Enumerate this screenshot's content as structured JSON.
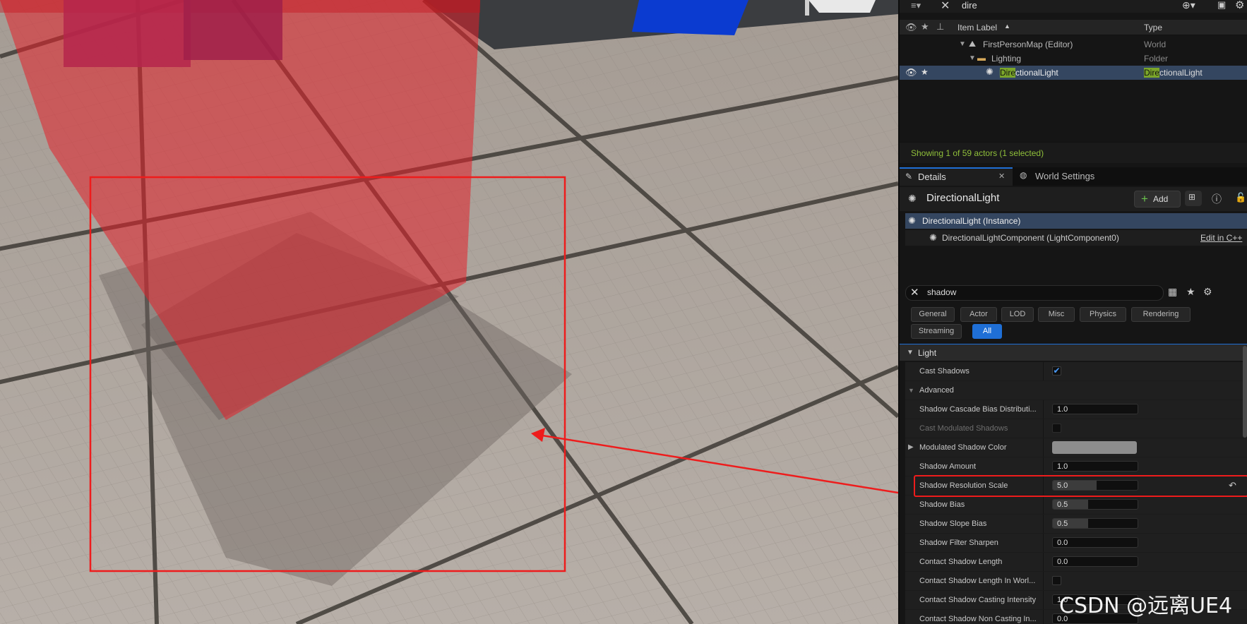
{
  "outliner": {
    "search_value": "dire",
    "col_label": "Item Label",
    "col_type": "Type",
    "rows": [
      {
        "label": "FirstPersonMap (Editor)",
        "type": "World"
      },
      {
        "label": "Lighting",
        "type": "Folder"
      },
      {
        "label_hl": "Dire",
        "label_rest": "ctionalLight",
        "type_hl": "Dire",
        "type_rest": "ctionalLight"
      }
    ],
    "status": "Showing 1 of 59 actors (1 selected)"
  },
  "tabs": {
    "details": "Details",
    "world_settings": "World Settings"
  },
  "details": {
    "actor_name": "DirectionalLight",
    "add_label": "Add",
    "instance_label": "DirectionalLight (Instance)",
    "component_label": "DirectionalLightComponent (LightComponent0)",
    "edit_cpp": "Edit in C++",
    "search_value": "shadow",
    "categories": [
      "General",
      "Actor",
      "LOD",
      "Misc",
      "Physics",
      "Rendering",
      "Streaming",
      "All"
    ],
    "section_light": "Light",
    "advanced_label": "Advanced",
    "props": {
      "cast_shadows": "Cast Shadows",
      "cascade_bias": "Shadow Cascade Bias Distributi...",
      "cascade_bias_val": "1.0",
      "cast_modulated": "Cast Modulated Shadows",
      "modulated_color": "Modulated Shadow Color",
      "shadow_amount": "Shadow Amount",
      "shadow_amount_val": "1.0",
      "res_scale": "Shadow Resolution Scale",
      "res_scale_val": "5.0",
      "shadow_bias": "Shadow Bias",
      "shadow_bias_val": "0.5",
      "slope_bias": "Shadow Slope Bias",
      "slope_bias_val": "0.5",
      "filter_sharpen": "Shadow Filter Sharpen",
      "filter_sharpen_val": "0.0",
      "contact_length": "Contact Shadow Length",
      "contact_length_val": "0.0",
      "contact_length_world": "Contact Shadow Length In Worl...",
      "casting_intensity": "Contact Shadow Casting Intensity",
      "casting_intensity_val": "1.0",
      "non_casting": "Contact Shadow Non Casting In...",
      "non_casting_val": "0.0"
    }
  },
  "watermark": "CSDN @远离UE4",
  "colors": {
    "accent": "#1f6fd6",
    "highlight": "#7aa52a",
    "annotation": "#ee1c1c"
  }
}
